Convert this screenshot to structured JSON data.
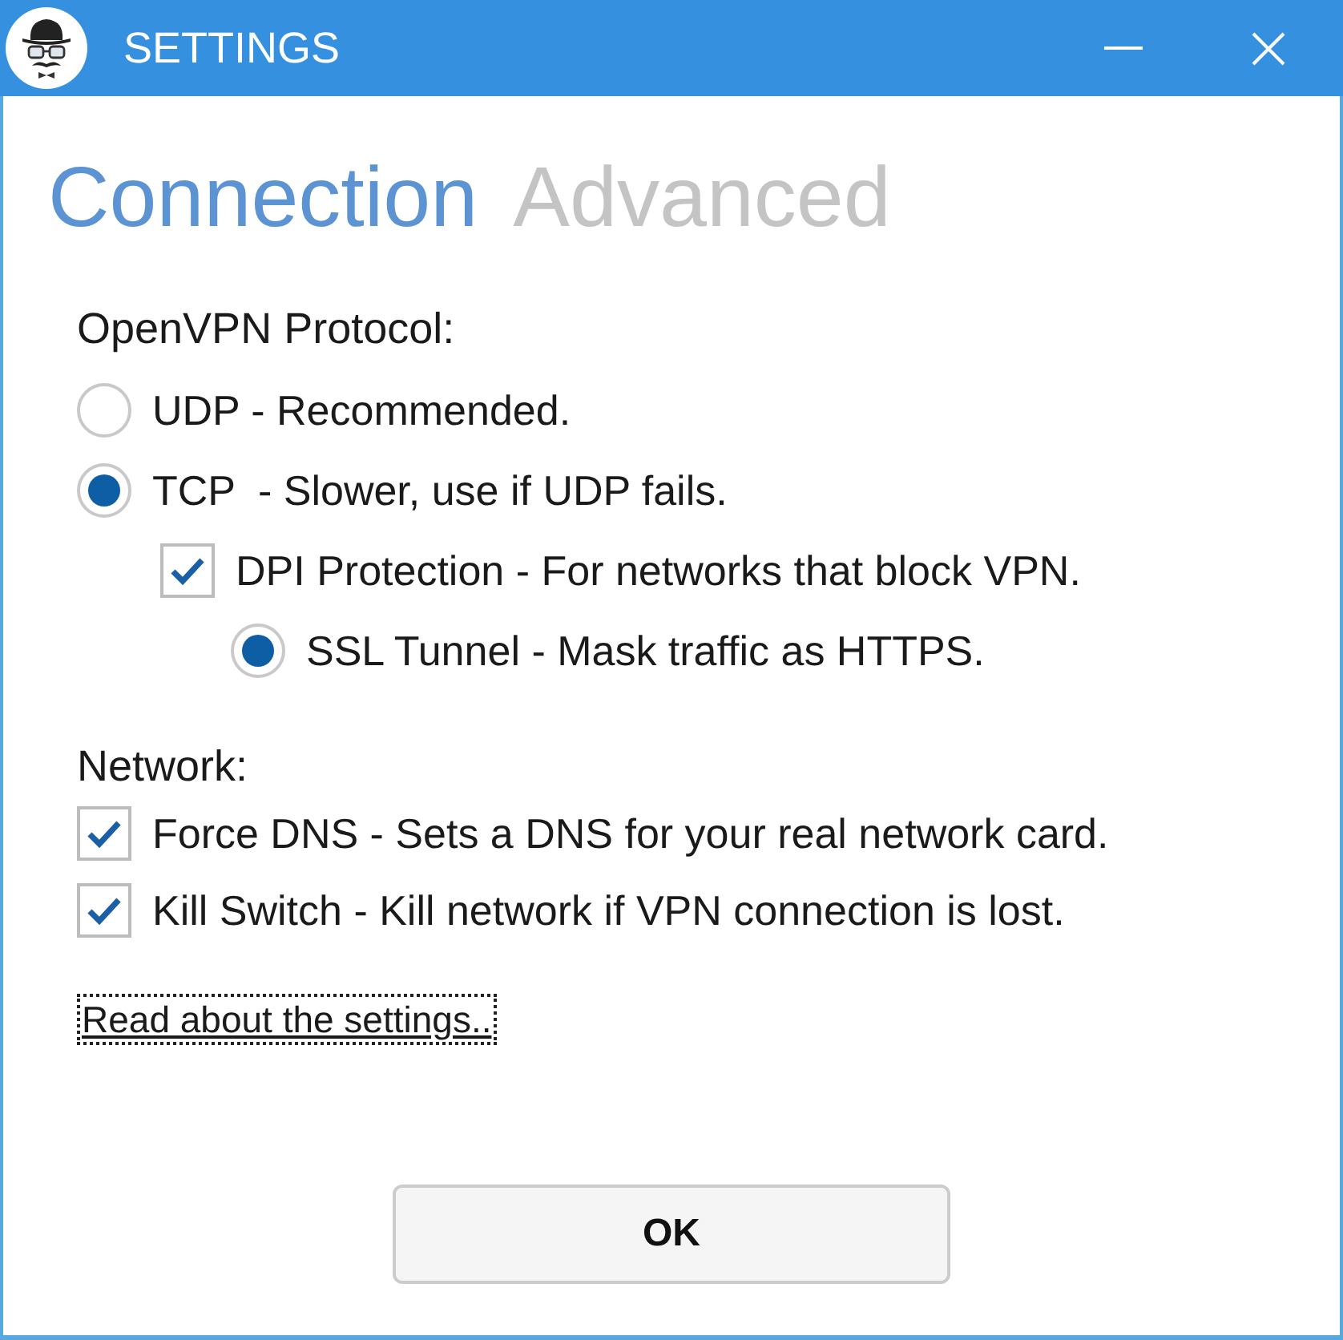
{
  "window": {
    "title": "SETTINGS"
  },
  "tabs": [
    {
      "label": "Connection",
      "selected": true
    },
    {
      "label": "Advanced",
      "selected": false
    }
  ],
  "protocol": {
    "label": "OpenVPN Protocol:",
    "options": [
      {
        "kind": "radio",
        "label": "UDP - Recommended.",
        "selected": false
      },
      {
        "kind": "radio",
        "label": "TCP  - Slower, use if UDP fails.",
        "selected": true,
        "children": [
          {
            "kind": "checkbox",
            "label": "DPI Protection - For networks that block VPN.",
            "checked": true,
            "children": [
              {
                "kind": "radio",
                "label": "SSL Tunnel - Mask traffic as HTTPS.",
                "selected": true
              }
            ]
          }
        ]
      }
    ]
  },
  "network": {
    "label": "Network:",
    "options": [
      {
        "kind": "checkbox",
        "label": "Force DNS - Sets a DNS for your real network card.",
        "checked": true
      },
      {
        "kind": "checkbox",
        "label": "Kill Switch - Kill network if VPN connection is lost.",
        "checked": true
      }
    ]
  },
  "link": {
    "text": "Read about the settings..",
    "focused": true
  },
  "buttons": [
    "OK"
  ]
}
